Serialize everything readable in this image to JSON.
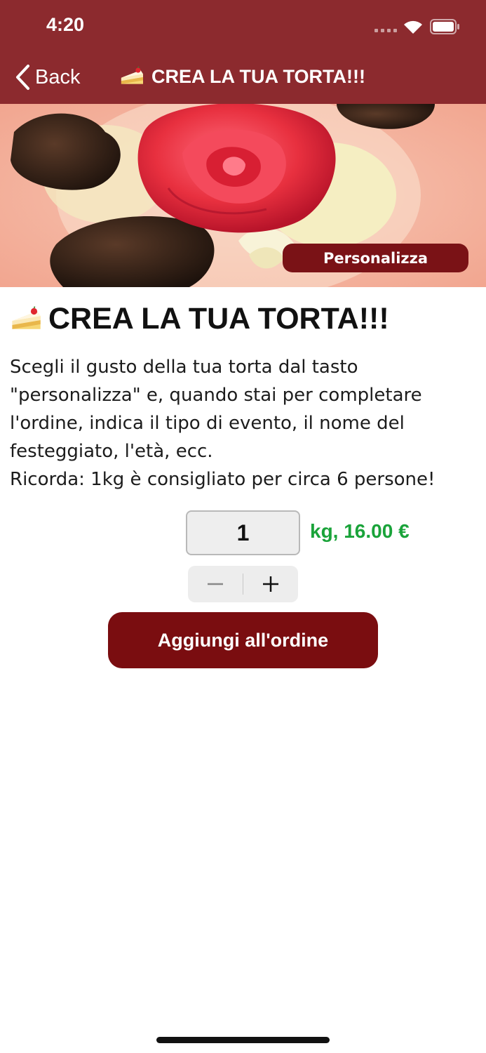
{
  "status_bar": {
    "time": "4:20"
  },
  "nav": {
    "back_label": "Back",
    "title": "CREA LA TUA TORTA!!!",
    "title_icon": "cake-slice-icon"
  },
  "hero": {
    "personalize_label": "Personalizza"
  },
  "product": {
    "title": "CREA LA TUA TORTA!!!",
    "description_lines": [
      "Scegli il gusto della tua torta dal tasto",
      "\"personalizza\" e, quando stai per completare",
      "l'ordine, indica il tipo di evento, il nome del",
      "festeggiato, l'età, ecc.",
      "Ricorda: 1kg  è consigliato per circa  6 persone!"
    ],
    "quantity": "1",
    "price_text": "kg, 16.00 €",
    "add_button_label": "Aggiungi all'ordine"
  },
  "colors": {
    "brand": "#8c2a2e",
    "button": "#7a0d10",
    "price": "#1aa33a"
  }
}
